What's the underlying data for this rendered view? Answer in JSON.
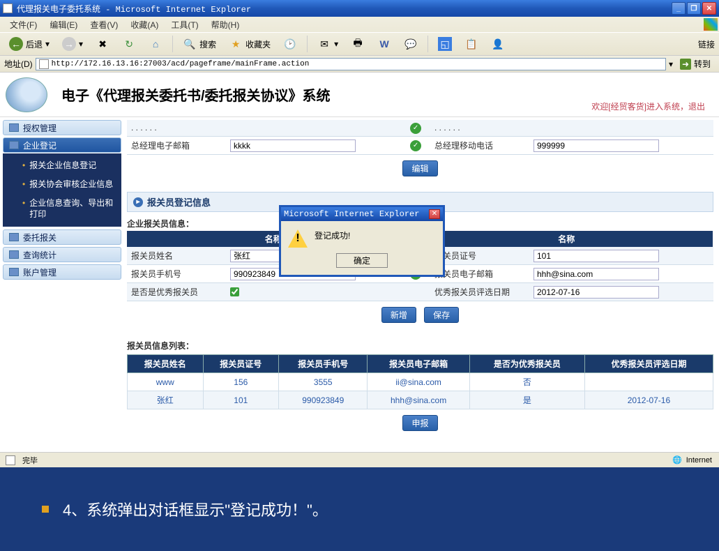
{
  "window": {
    "title": "代理报关电子委托系统 - Microsoft Internet Explorer"
  },
  "menubar": {
    "file": "文件(F)",
    "edit": "编辑(E)",
    "view": "查看(V)",
    "favorites": "收藏(A)",
    "tools": "工具(T)",
    "help": "帮助(H)"
  },
  "toolbar": {
    "back": "后退",
    "search": "搜索",
    "favorites": "收藏夹",
    "links": "链接"
  },
  "addressbar": {
    "label": "地址(D)",
    "url": "http://172.16.13.16:27003/acd/pageframe/mainFrame.action",
    "go": "转到"
  },
  "app": {
    "title": "电子《代理报关委托书/委托报关协议》系统",
    "welcome_prefix": "欢迎[",
    "welcome_user": "经贸客货",
    "welcome_suffix": "]进入系统，退出"
  },
  "sidebar": {
    "items": [
      {
        "label": "授权管理"
      },
      {
        "label": "企业登记"
      },
      {
        "label": "委托报关"
      },
      {
        "label": "查询统计"
      },
      {
        "label": "账户管理"
      }
    ],
    "sub": [
      {
        "label": "报关企业信息登记"
      },
      {
        "label": "报关协会审核企业信息"
      },
      {
        "label": "企业信息查询、导出和打印"
      }
    ]
  },
  "form_top": {
    "email_label": "总经理电子邮箱",
    "email_value": "kkkk",
    "phone_label": "总经理移动电话",
    "phone_value": "999999",
    "edit_btn": "编辑"
  },
  "section": {
    "title": "报关员登记信息",
    "company_info": "企业报关员信息：",
    "col_name": "名称",
    "row1_l": "报关员姓名",
    "row1_lv": "张红",
    "row1_r": "报关员证号",
    "row1_rv": "101",
    "row2_l": "报关员手机号",
    "row2_lv": "990923849",
    "row2_r": "报关员电子邮箱",
    "row2_rv": "hhh@sina.com",
    "row3_l": "是否是优秀报关员",
    "row3_r": "优秀报关员评选日期",
    "row3_rv": "2012-07-16",
    "add_btn": "新增",
    "save_btn": "保存"
  },
  "list": {
    "title": "报关员信息列表：",
    "headers": [
      "报关员姓名",
      "报关员证号",
      "报关员手机号",
      "报关员电子邮箱",
      "是否为优秀报关员",
      "优秀报关员评选日期"
    ],
    "rows": [
      [
        "www",
        "156",
        "3555",
        "ii@sina.com",
        "否",
        ""
      ],
      [
        "张红",
        "101",
        "990923849",
        "hhh@sina.com",
        "是",
        "2012-07-16"
      ]
    ],
    "report_btn": "申报"
  },
  "dialog": {
    "title": "Microsoft Internet Explorer",
    "message": "登记成功!",
    "ok": "确定"
  },
  "statusbar": {
    "done": "完毕",
    "zone": "Internet"
  },
  "caption": "4、系统弹出对话框显示\"登记成功！\"。"
}
